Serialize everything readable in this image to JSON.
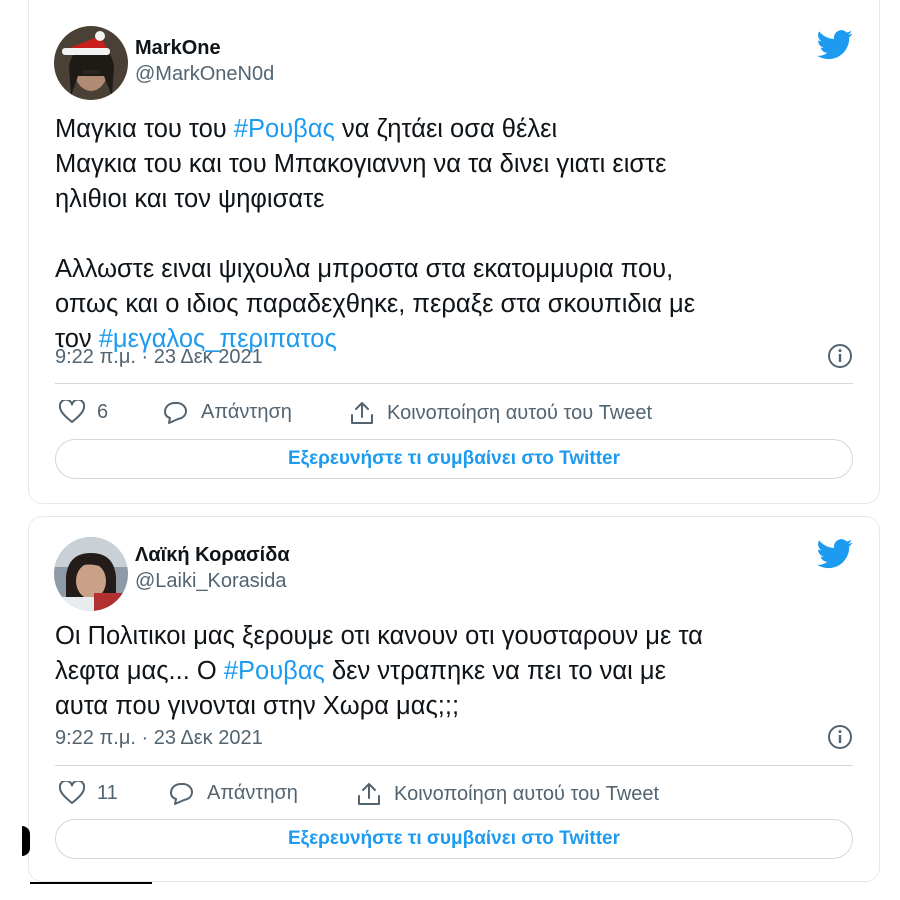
{
  "colors": {
    "accent": "#1d9bf0",
    "text": "#0f1419",
    "secondary": "#536471",
    "border": "#cfd9de"
  },
  "tweets": [
    {
      "display_name": "MarkOne",
      "handle": "@MarkOneN0d",
      "body": [
        [
          "Μαγκια του του ",
          "#Ρουβας",
          " να ζητάει οσα θέλει"
        ],
        [
          "Μαγκια του και του Μπακογιαννη να τα δινει γιατι ειστε"
        ],
        [
          "ηλιθιοι και τον ψηφισατε"
        ],
        [
          ""
        ],
        [
          "Αλλωστε ειναι ψιχουλα μπροστα στα εκατομμυρια που,"
        ],
        [
          "οπως και ο ιδιος παραδεχθηκε, περαξε στα σκουπιδια με"
        ],
        [
          "τον ",
          "#μεγαλος_περιπατος"
        ]
      ],
      "timestamp": "9:22 π.μ. · 23 Δεκ 2021",
      "like_count": "6",
      "reply_label": "Απάντηση",
      "share_label": "Κοινοποίηση αυτού του Tweet",
      "explore_label": "Εξερευνήστε τι συμβαίνει στο Twitter",
      "icons": [
        "twitter-bird-icon",
        "info-icon",
        "heart-icon",
        "reply-icon",
        "share-icon"
      ]
    },
    {
      "display_name": "Λαϊκή Κορασίδα",
      "handle": "@Laiki_Korasida",
      "body": [
        [
          "Οι Πολιτικοι μας ξερουμε οτι κανουν οτι γουσταρουν με τα"
        ],
        [
          "λεφτα μας... Ο ",
          "#Ρουβας",
          " δεν ντραπηκε να πει το ναι με"
        ],
        [
          "αυτα που γινονται στην Χωρα μας;;;"
        ]
      ],
      "timestamp": "9:22 π.μ. · 23 Δεκ 2021",
      "like_count": "11",
      "reply_label": "Απάντηση",
      "share_label": "Κοινοποίηση αυτού του Tweet",
      "explore_label": "Εξερευνήστε τι συμβαίνει στο Twitter",
      "icons": [
        "twitter-bird-icon",
        "info-icon",
        "heart-icon",
        "reply-icon",
        "share-icon"
      ]
    }
  ]
}
